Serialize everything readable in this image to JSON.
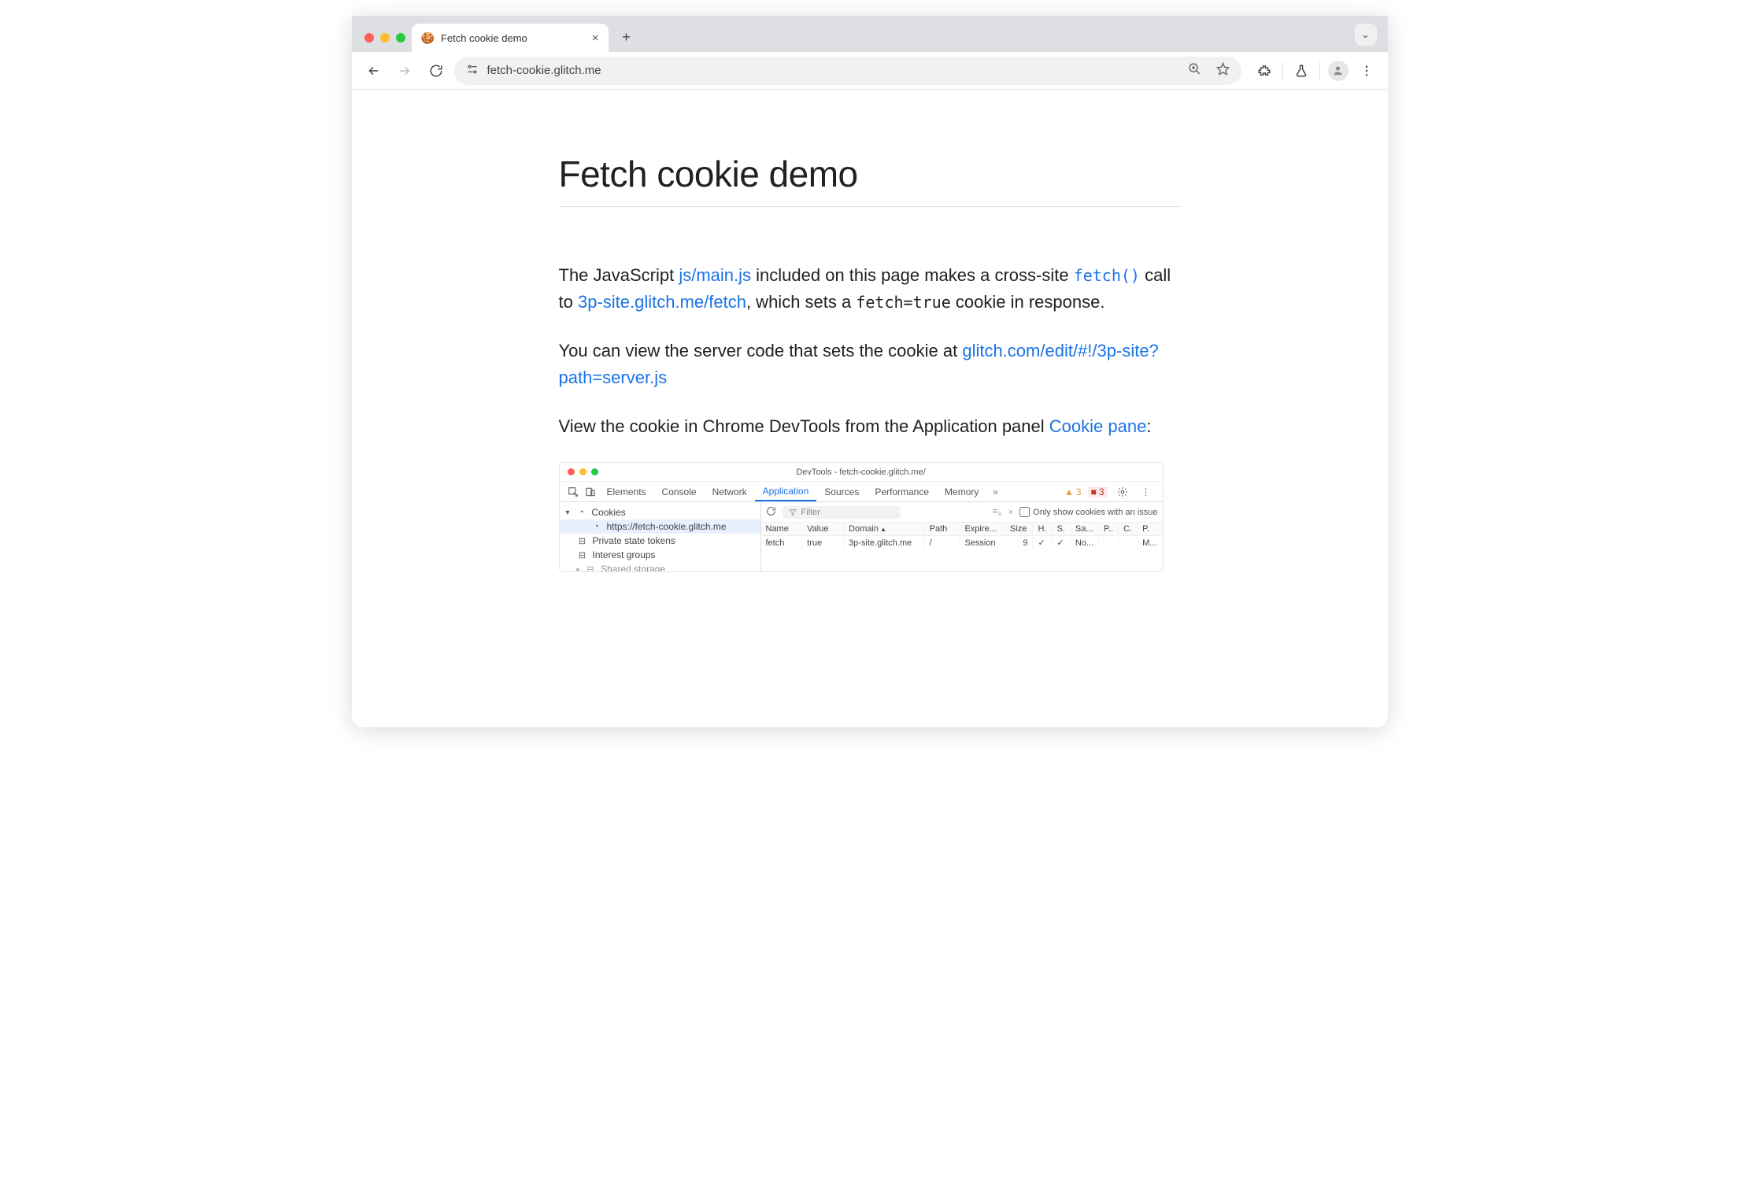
{
  "browser": {
    "tab": {
      "title": "Fetch cookie demo",
      "favicon": "🍪"
    },
    "url": "fetch-cookie.glitch.me",
    "dropdown_tooltip": "⌄"
  },
  "page": {
    "heading": "Fetch cookie demo",
    "p1_a": "The JavaScript ",
    "p1_link1": "js/main.js",
    "p1_b": " included on this page makes a cross-site ",
    "p1_code1": "fetch()",
    "p1_c": " call to ",
    "p1_link2": "3p-site.glitch.me/fetch",
    "p1_d": ", which sets a ",
    "p1_code2": "fetch=true",
    "p1_e": " cookie in response.",
    "p2_a": "You can view the server code that sets the cookie at ",
    "p2_link": "glitch.com/edit/#!/3p-site?path=server.js",
    "p3_a": "View the cookie in Chrome DevTools from the Application panel ",
    "p3_link": "Cookie pane",
    "p3_b": ":"
  },
  "devtools": {
    "title": "DevTools - fetch-cookie.glitch.me/",
    "tabs": [
      "Elements",
      "Console",
      "Network",
      "Application",
      "Sources",
      "Performance",
      "Memory"
    ],
    "active_tab": "Application",
    "warnings": "3",
    "errors": "3",
    "filter_placeholder": "Filter",
    "only_issues": "Only show cookies with an issue",
    "side": {
      "cookies": "Cookies",
      "cookie_url": "https://fetch-cookie.glitch.me",
      "pst": "Private state tokens",
      "ig": "Interest groups",
      "ss": "Shared storage"
    },
    "columns": [
      "Name",
      "Value",
      "Domain",
      "Path",
      "Expire...",
      "Size",
      "H.",
      "S.",
      "Sa...",
      "P..",
      "C.",
      "P."
    ],
    "row": {
      "name": "fetch",
      "value": "true",
      "domain": "3p-site.glitch.me",
      "path": "/",
      "expires": "Session",
      "size": "9",
      "http": "✓",
      "secure": "✓",
      "samesite": "No...",
      "partition": "",
      "cross": "",
      "priority": "M..."
    }
  }
}
